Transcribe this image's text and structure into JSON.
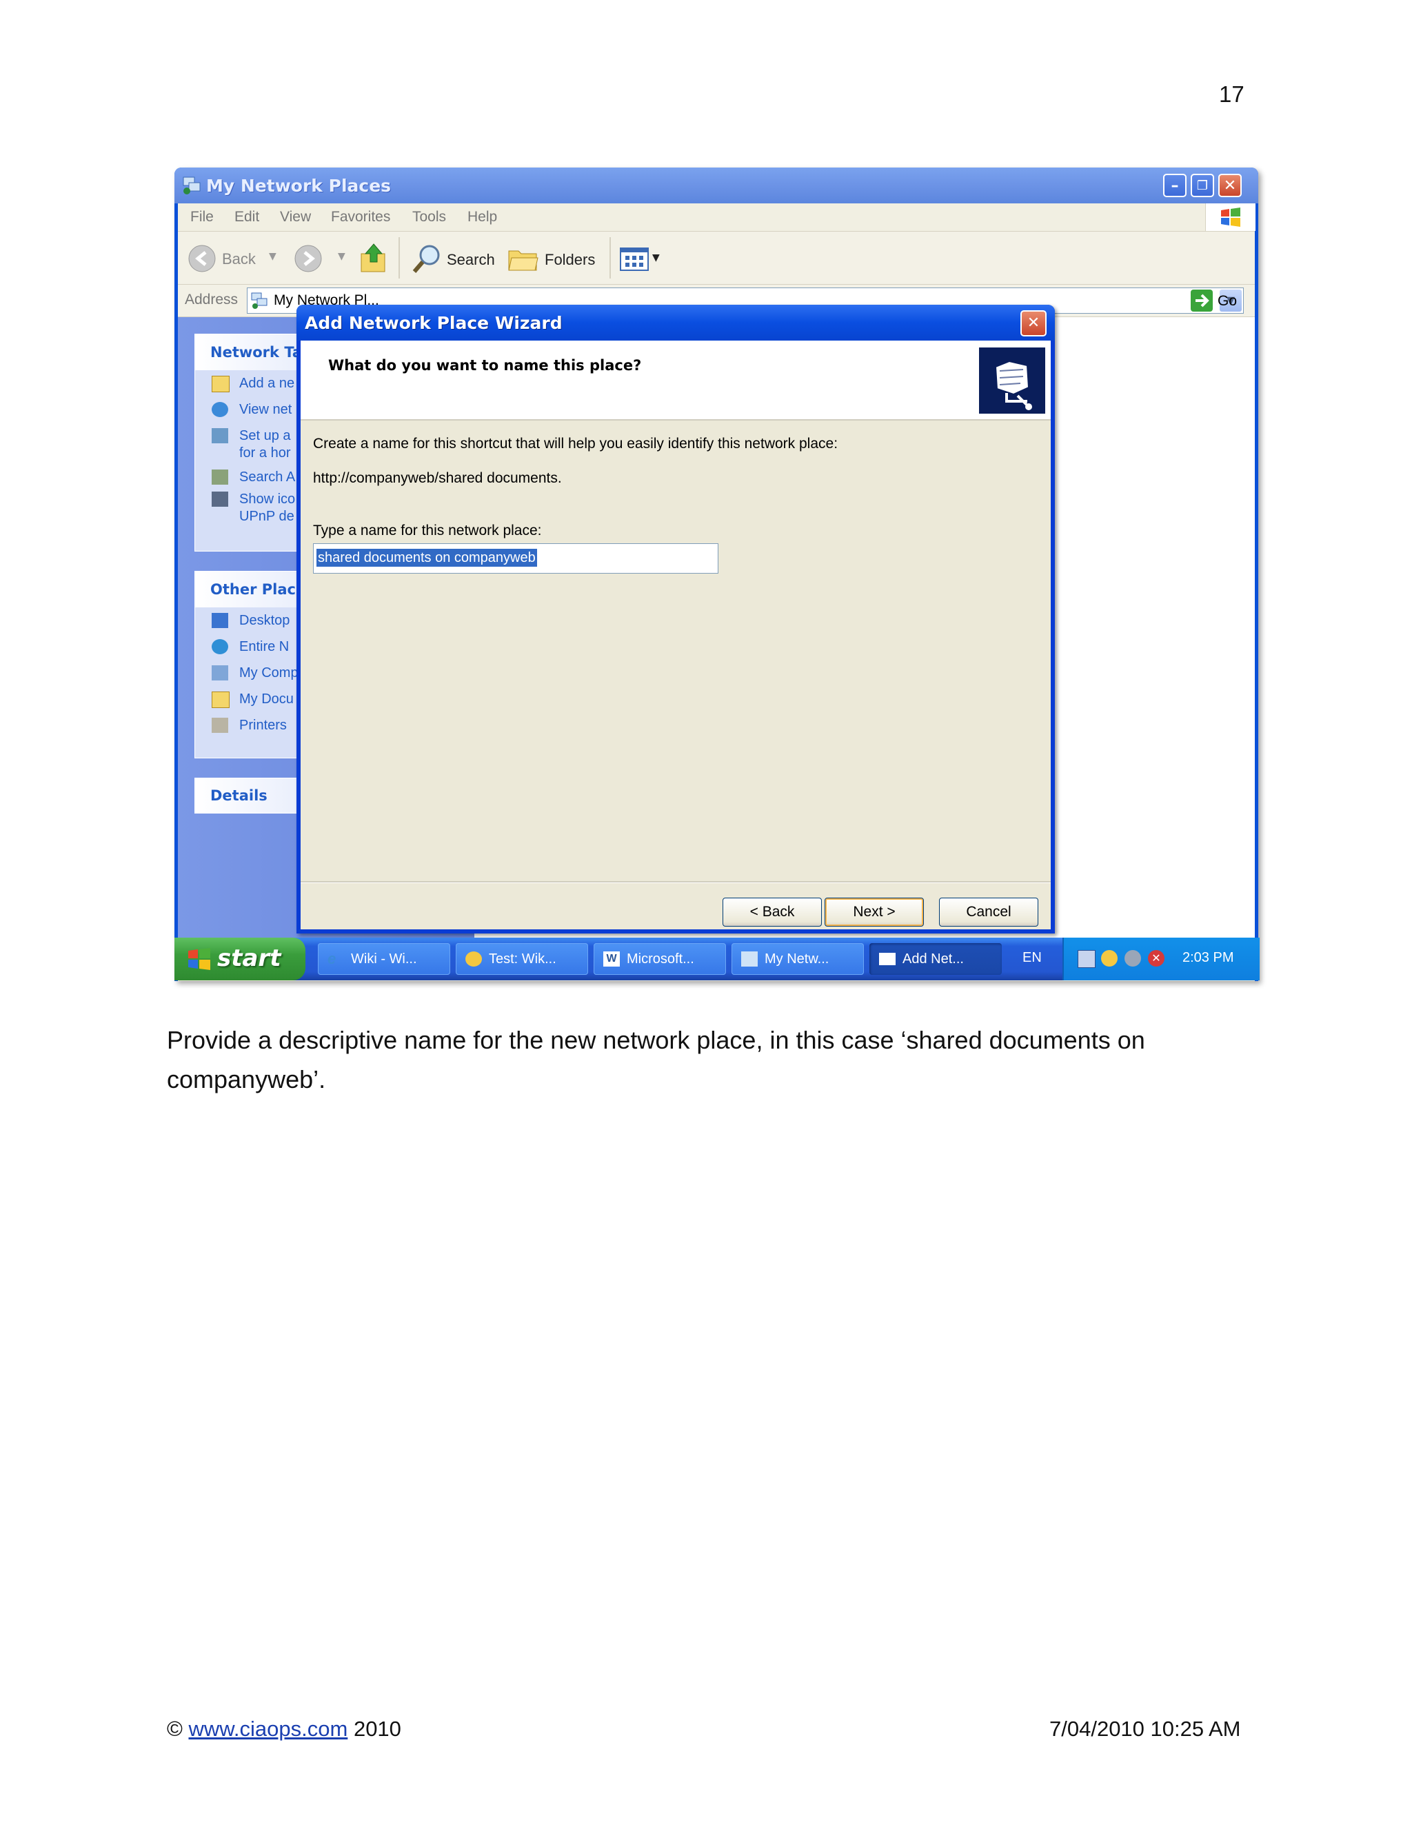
{
  "page_number": "17",
  "explorer": {
    "title": "My Network Places",
    "menu": [
      "File",
      "Edit",
      "View",
      "Favorites",
      "Tools",
      "Help"
    ],
    "toolbar": {
      "back": "Back",
      "search": "Search",
      "folders": "Folders"
    },
    "address_label": "Address",
    "address_value": "My Network Pl...",
    "go": "Go",
    "network_tasks": {
      "title": "Network Ta",
      "items": [
        "Add a ne",
        "View net",
        "Set up a",
        "for a hor",
        "Search A",
        "Show ico",
        "UPnP de"
      ]
    },
    "other_places": {
      "title": "Other Place",
      "items": [
        "Desktop",
        "Entire N",
        "My Comp",
        "My Docu",
        "Printers"
      ]
    },
    "details": {
      "title": "Details"
    }
  },
  "wizard": {
    "title": "Add Network Place Wizard",
    "heading": "What do you want to name this place?",
    "instruction": "Create a name for this shortcut that will help you easily identify this network place:",
    "url": "http://companyweb/shared documents.",
    "field_label": "Type a name for this network place:",
    "field_value": "shared documents on companyweb",
    "buttons": {
      "back": "< Back",
      "next": "Next >",
      "cancel": "Cancel"
    }
  },
  "taskbar": {
    "start": "start",
    "tasks": [
      "Wiki - Wi...",
      "Test: Wik...",
      "Microsoft...",
      "My Netw...",
      "Add Net..."
    ],
    "language": "EN",
    "clock": "2:03 PM"
  },
  "caption": "Provide a descriptive name for the new network place, in this case ‘shared documents on companyweb’.",
  "footer": {
    "copyright_symbol": "©",
    "link": "www.ciaops.com",
    "year": "2010",
    "timestamp": "7/04/2010 10:25 AM"
  },
  "colors": {
    "xp_title_blue": "#0a50d8",
    "task_pane_blue": "#215dc6",
    "selection_blue": "#316ac5",
    "start_green": "#3a9d3c"
  }
}
